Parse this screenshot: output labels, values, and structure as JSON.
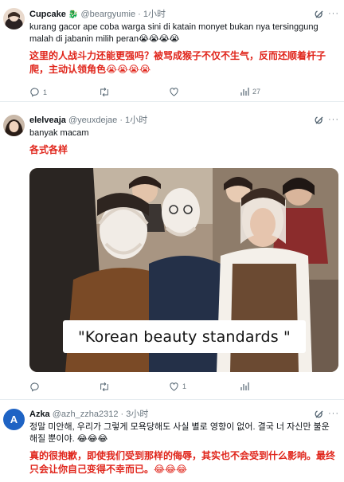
{
  "posts": [
    {
      "username": "Cupcake",
      "username_emoji": "🐉",
      "handle": "@beargyumie",
      "time": "· 1小时",
      "text": "kurang gacor ape coba warga sini di katain monyet bukan nya tersinggung malah di jabanin milih peran😭😭😭😭",
      "translation": "这里的人战斗力还能更强吗？被骂成猴子不仅不生气，反而还顺着杆子爬，主动认领角色😭😭😭😭",
      "reply_count": "1",
      "retweet_count": "",
      "like_count": "",
      "view_count": "27"
    },
    {
      "username": "elelveaja",
      "handle": "@yeuxdejae",
      "time": "· 1小时",
      "text": "banyak macam",
      "translation": "各式各样",
      "media_caption": "\"Korean beauty standards \"",
      "reply_count": "",
      "retweet_count": "",
      "like_count": "1"
    },
    {
      "username": "Azka",
      "handle": "@azh_zzha2312",
      "time": "· 3小时",
      "avatar_letter": "A",
      "text": "정말 미안해, 우리가 그렇게 모욕당해도 사실 별로 영향이 없어. 결국 너 자신만 불운해질 뿐이야. 😂😂😂",
      "translation": "真的很抱歉，即使我们受到那样的侮辱，其实也不会受到什么影响。最终只会让你自己变得不幸而已。😂😂😂"
    }
  ],
  "icons": {
    "reply": "reply-icon",
    "retweet": "retweet-icon",
    "like": "like-icon",
    "views": "views-icon",
    "grok": "grok-icon",
    "more": "more-icon"
  },
  "colors": {
    "translation_red": "#e0251b",
    "muted": "#6b7780",
    "azka_avatar": "#1e63c4"
  }
}
